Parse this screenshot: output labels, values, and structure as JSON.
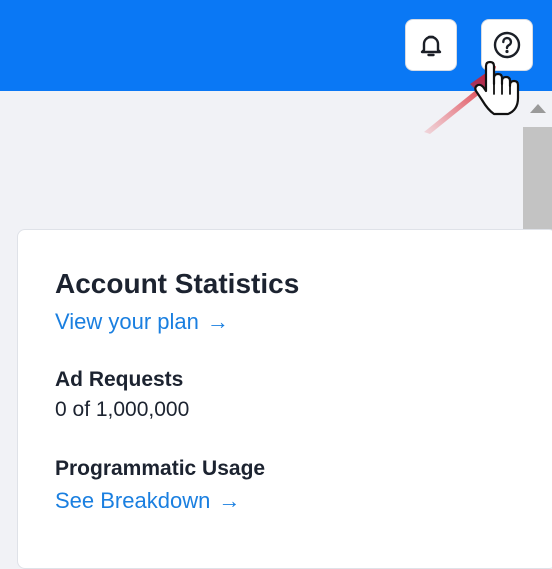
{
  "header": {
    "notifications_icon": "bell-icon",
    "help_icon": "question-circle-icon",
    "bar_color": "#0a78f5"
  },
  "card": {
    "title": "Account Statistics",
    "plan_link": "View your plan",
    "ad_requests": {
      "label": "Ad Requests",
      "value": "0 of 1,000,000"
    },
    "programmatic": {
      "label": "Programmatic Usage",
      "link": "See Breakdown"
    },
    "arrow_glyph": "→"
  }
}
